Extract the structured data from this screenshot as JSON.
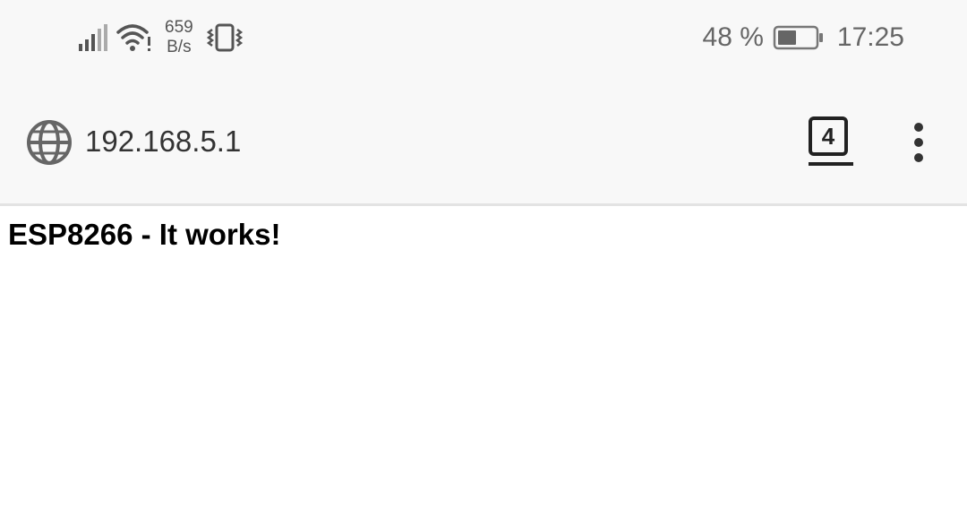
{
  "status_bar": {
    "net_speed_value": "659",
    "net_speed_unit": "B/s",
    "battery_percent": "48 %",
    "time": "17:25",
    "icons": [
      "signal-icon",
      "wifi-icon",
      "vibrate-icon",
      "battery-icon"
    ]
  },
  "browser": {
    "url": "192.168.5.1",
    "tab_count": "4",
    "icons": [
      "globe-icon",
      "tabs-icon",
      "more-vert-icon"
    ]
  },
  "page": {
    "heading": "ESP8266 - It works!"
  },
  "colors": {
    "chrome_bg": "#f8f8f8",
    "page_bg": "#ffffff",
    "icon_dark": "#222222",
    "icon_gray": "#666666"
  }
}
